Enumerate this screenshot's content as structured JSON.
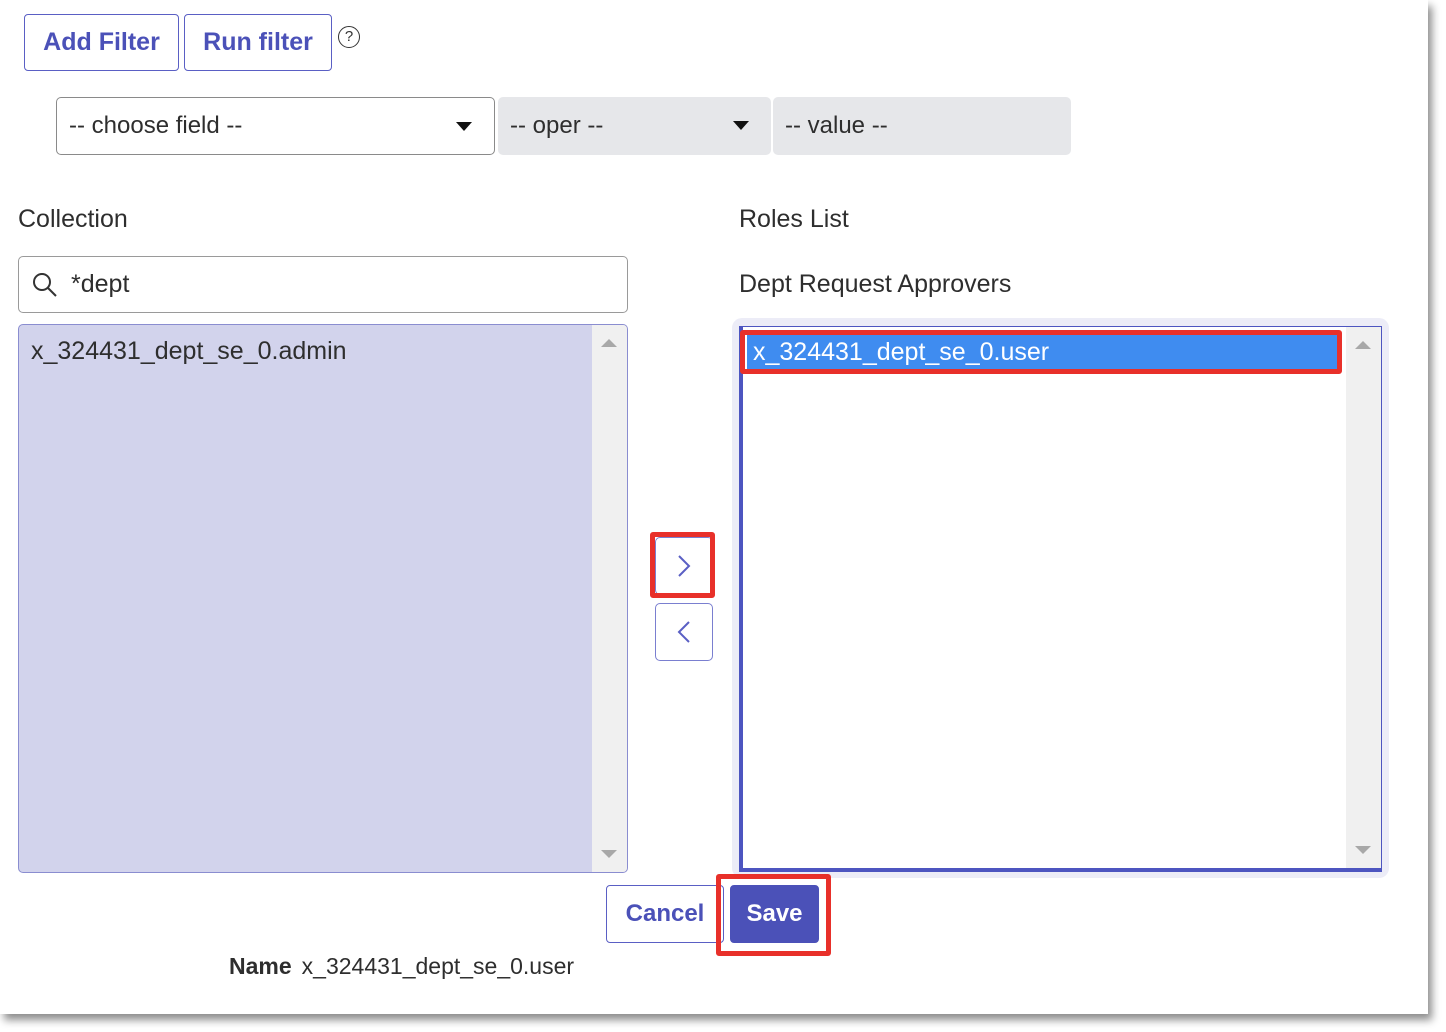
{
  "toolbar": {
    "add_filter_label": "Add Filter",
    "run_filter_label": "Run filter",
    "help_icon": "question-circle-icon"
  },
  "filter": {
    "field_placeholder": "-- choose field --",
    "oper_placeholder": "-- oper --",
    "value_placeholder": "-- value --"
  },
  "collection": {
    "label": "Collection",
    "search_value": "*dept",
    "items": [
      "x_324431_dept_se_0.admin"
    ]
  },
  "roles": {
    "label": "Roles List",
    "group_label": "Dept Request Approvers",
    "items": [
      "x_324431_dept_se_0.user"
    ],
    "selected_index": 0
  },
  "actions": {
    "move_right_icon": "chevron-right-icon",
    "move_left_icon": "chevron-left-icon",
    "cancel_label": "Cancel",
    "save_label": "Save"
  },
  "footer": {
    "name_label": "Name",
    "name_value": "x_324431_dept_se_0.user"
  },
  "colors": {
    "accent": "#4b51b8",
    "selection": "#3f8cf0",
    "highlight": "#e8302a",
    "collection_bg": "#d2d3ec"
  }
}
